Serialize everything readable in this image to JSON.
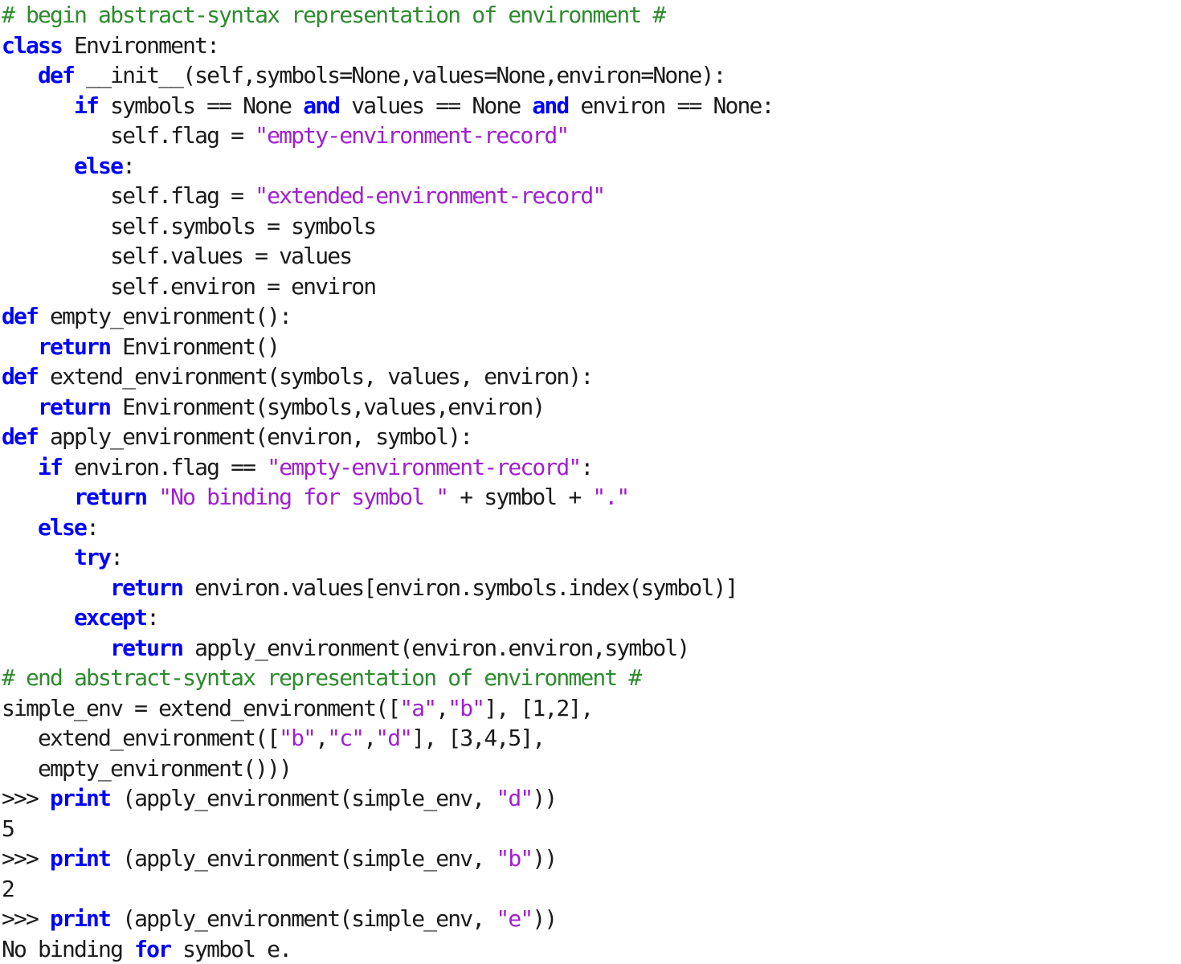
{
  "document": {
    "kind": "python-source-listing",
    "language": "Python",
    "background_color": "#ffffff",
    "colors": {
      "keyword": "#0000ff",
      "string": "#a020d0",
      "comment": "#2e8b2e",
      "plain_text": "#1a1a1a"
    }
  },
  "lines": [
    {
      "n": 1,
      "text": "# begin abstract-syntax representation of environment #",
      "tokens": [
        {
          "t": "# begin abstract-syntax representation of environment #",
          "c": "cmt"
        }
      ]
    },
    {
      "n": 2,
      "text": "class Environment:",
      "tokens": [
        {
          "t": "class",
          "c": "kw"
        },
        {
          "t": " Environment:",
          "c": "plain"
        }
      ]
    },
    {
      "n": 3,
      "text": "   def __init__(self,symbols=None,values=None,environ=None):",
      "tokens": [
        {
          "t": "   ",
          "c": "plain"
        },
        {
          "t": "def",
          "c": "kw"
        },
        {
          "t": " __init__(self,symbols=None,values=None,environ=None):",
          "c": "plain"
        }
      ]
    },
    {
      "n": 4,
      "text": "      if symbols == None and values == None and environ == None:",
      "tokens": [
        {
          "t": "      ",
          "c": "plain"
        },
        {
          "t": "if",
          "c": "kw"
        },
        {
          "t": " symbols == None ",
          "c": "plain"
        },
        {
          "t": "and",
          "c": "kw"
        },
        {
          "t": " values == None ",
          "c": "plain"
        },
        {
          "t": "and",
          "c": "kw"
        },
        {
          "t": " environ == None:",
          "c": "plain"
        }
      ]
    },
    {
      "n": 5,
      "text": "         self.flag = \"empty-environment-record\"",
      "tokens": [
        {
          "t": "         self.flag = ",
          "c": "plain"
        },
        {
          "t": "\"empty-environment-record\"",
          "c": "str"
        }
      ]
    },
    {
      "n": 6,
      "text": "      else:",
      "tokens": [
        {
          "t": "      ",
          "c": "plain"
        },
        {
          "t": "else",
          "c": "kw"
        },
        {
          "t": ":",
          "c": "plain"
        }
      ]
    },
    {
      "n": 7,
      "text": "         self.flag = \"extended-environment-record\"",
      "tokens": [
        {
          "t": "         self.flag = ",
          "c": "plain"
        },
        {
          "t": "\"extended-environment-record\"",
          "c": "str"
        }
      ]
    },
    {
      "n": 8,
      "text": "         self.symbols = symbols",
      "tokens": [
        {
          "t": "         self.symbols = symbols",
          "c": "plain"
        }
      ]
    },
    {
      "n": 9,
      "text": "         self.values = values",
      "tokens": [
        {
          "t": "         self.values = values",
          "c": "plain"
        }
      ]
    },
    {
      "n": 10,
      "text": "         self.environ = environ",
      "tokens": [
        {
          "t": "         self.environ = environ",
          "c": "plain"
        }
      ]
    },
    {
      "n": 11,
      "text": "def empty_environment():",
      "tokens": [
        {
          "t": "def",
          "c": "kw"
        },
        {
          "t": " empty_environment():",
          "c": "plain"
        }
      ]
    },
    {
      "n": 12,
      "text": "   return Environment()",
      "tokens": [
        {
          "t": "   ",
          "c": "plain"
        },
        {
          "t": "return",
          "c": "kw"
        },
        {
          "t": " Environment()",
          "c": "plain"
        }
      ]
    },
    {
      "n": 13,
      "text": "def extend_environment(symbols, values, environ):",
      "tokens": [
        {
          "t": "def",
          "c": "kw"
        },
        {
          "t": " extend_environment(symbols, values, environ):",
          "c": "plain"
        }
      ]
    },
    {
      "n": 14,
      "text": "   return Environment(symbols,values,environ)",
      "tokens": [
        {
          "t": "   ",
          "c": "plain"
        },
        {
          "t": "return",
          "c": "kw"
        },
        {
          "t": " Environment(symbols,values,environ)",
          "c": "plain"
        }
      ]
    },
    {
      "n": 15,
      "text": "def apply_environment(environ, symbol):",
      "tokens": [
        {
          "t": "def",
          "c": "kw"
        },
        {
          "t": " apply_environment(environ, symbol):",
          "c": "plain"
        }
      ]
    },
    {
      "n": 16,
      "text": "   if environ.flag == \"empty-environment-record\":",
      "tokens": [
        {
          "t": "   ",
          "c": "plain"
        },
        {
          "t": "if",
          "c": "kw"
        },
        {
          "t": " environ.flag == ",
          "c": "plain"
        },
        {
          "t": "\"empty-environment-record\"",
          "c": "str"
        },
        {
          "t": ":",
          "c": "plain"
        }
      ]
    },
    {
      "n": 17,
      "text": "      return \"No binding for symbol \" + symbol + \".\"",
      "tokens": [
        {
          "t": "      ",
          "c": "plain"
        },
        {
          "t": "return",
          "c": "kw"
        },
        {
          "t": " ",
          "c": "plain"
        },
        {
          "t": "\"No binding for symbol \"",
          "c": "str"
        },
        {
          "t": " + symbol + ",
          "c": "plain"
        },
        {
          "t": "\".\"",
          "c": "str"
        }
      ]
    },
    {
      "n": 18,
      "text": "   else:",
      "tokens": [
        {
          "t": "   ",
          "c": "plain"
        },
        {
          "t": "else",
          "c": "kw"
        },
        {
          "t": ":",
          "c": "plain"
        }
      ]
    },
    {
      "n": 19,
      "text": "      try:",
      "tokens": [
        {
          "t": "      ",
          "c": "plain"
        },
        {
          "t": "try",
          "c": "kw"
        },
        {
          "t": ":",
          "c": "plain"
        }
      ]
    },
    {
      "n": 20,
      "text": "         return environ.values[environ.symbols.index(symbol)]",
      "tokens": [
        {
          "t": "         ",
          "c": "plain"
        },
        {
          "t": "return",
          "c": "kw"
        },
        {
          "t": " environ.values[environ.symbols.index(symbol)]",
          "c": "plain"
        }
      ]
    },
    {
      "n": 21,
      "text": "      except:",
      "tokens": [
        {
          "t": "      ",
          "c": "plain"
        },
        {
          "t": "except",
          "c": "kw"
        },
        {
          "t": ":",
          "c": "plain"
        }
      ]
    },
    {
      "n": 22,
      "text": "         return apply_environment(environ.environ,symbol)",
      "tokens": [
        {
          "t": "         ",
          "c": "plain"
        },
        {
          "t": "return",
          "c": "kw"
        },
        {
          "t": " apply_environment(environ.environ,symbol)",
          "c": "plain"
        }
      ]
    },
    {
      "n": 23,
      "text": "# end abstract-syntax representation of environment #",
      "tokens": [
        {
          "t": "# end abstract-syntax representation of environment #",
          "c": "cmt"
        }
      ]
    },
    {
      "n": 24,
      "text": "simple_env = extend_environment([\"a\",\"b\"], [1,2],",
      "tokens": [
        {
          "t": "simple_env = extend_environment([",
          "c": "plain"
        },
        {
          "t": "\"a\"",
          "c": "str"
        },
        {
          "t": ",",
          "c": "plain"
        },
        {
          "t": "\"b\"",
          "c": "str"
        },
        {
          "t": "], [1,2],",
          "c": "plain"
        }
      ]
    },
    {
      "n": 25,
      "text": "   extend_environment([\"b\",\"c\",\"d\"], [3,4,5],",
      "tokens": [
        {
          "t": "   extend_environment([",
          "c": "plain"
        },
        {
          "t": "\"b\"",
          "c": "str"
        },
        {
          "t": ",",
          "c": "plain"
        },
        {
          "t": "\"c\"",
          "c": "str"
        },
        {
          "t": ",",
          "c": "plain"
        },
        {
          "t": "\"d\"",
          "c": "str"
        },
        {
          "t": "], [3,4,5],",
          "c": "plain"
        }
      ]
    },
    {
      "n": 26,
      "text": "   empty_environment()))",
      "tokens": [
        {
          "t": "   empty_environment()))",
          "c": "plain"
        }
      ]
    },
    {
      "n": 27,
      "text": ">>> print (apply_environment(simple_env, \"d\"))",
      "tokens": [
        {
          "t": ">>> ",
          "c": "plain"
        },
        {
          "t": "print",
          "c": "kw"
        },
        {
          "t": " (apply_environment(simple_env, ",
          "c": "plain"
        },
        {
          "t": "\"d\"",
          "c": "str"
        },
        {
          "t": "))",
          "c": "plain"
        }
      ]
    },
    {
      "n": 28,
      "text": "5",
      "tokens": [
        {
          "t": "5",
          "c": "plain"
        }
      ]
    },
    {
      "n": 29,
      "text": ">>> print (apply_environment(simple_env, \"b\"))",
      "tokens": [
        {
          "t": ">>> ",
          "c": "plain"
        },
        {
          "t": "print",
          "c": "kw"
        },
        {
          "t": " (apply_environment(simple_env, ",
          "c": "plain"
        },
        {
          "t": "\"b\"",
          "c": "str"
        },
        {
          "t": "))",
          "c": "plain"
        }
      ]
    },
    {
      "n": 30,
      "text": "2",
      "tokens": [
        {
          "t": "2",
          "c": "plain"
        }
      ]
    },
    {
      "n": 31,
      "text": ">>> print (apply_environment(simple_env, \"e\"))",
      "tokens": [
        {
          "t": ">>> ",
          "c": "plain"
        },
        {
          "t": "print",
          "c": "kw"
        },
        {
          "t": " (apply_environment(simple_env, ",
          "c": "plain"
        },
        {
          "t": "\"e\"",
          "c": "str"
        },
        {
          "t": "))",
          "c": "plain"
        }
      ]
    },
    {
      "n": 32,
      "text": "No binding for symbol e.",
      "tokens": [
        {
          "t": "No binding ",
          "c": "plain"
        },
        {
          "t": "for",
          "c": "kw"
        },
        {
          "t": " symbol e.",
          "c": "plain"
        }
      ]
    }
  ]
}
